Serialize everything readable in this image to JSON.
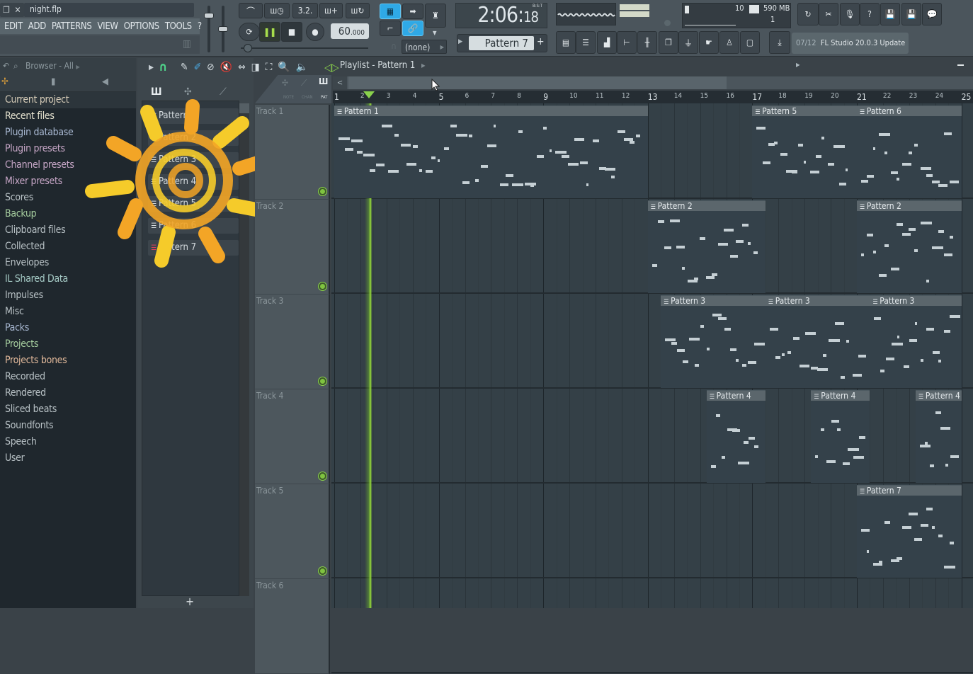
{
  "window": {
    "title": "night.flp"
  },
  "menu": [
    "EDIT",
    "ADD",
    "PATTERNS",
    "VIEW",
    "OPTIONS",
    "TOOLS",
    "?"
  ],
  "transport": {
    "time_main": "2:06",
    "time_sub": "18",
    "time_mode": "B:S:T",
    "tempo_main": "60",
    "tempo_sub": ".000",
    "pattern_selected": "Pattern 7",
    "snap_value": "(none)",
    "state": "playing"
  },
  "toolbar_buttons": [
    "metronome",
    "wait-for-input",
    "countdown-3-2-1",
    "blend-notes",
    "loop-record",
    "step-edit",
    "typing-keyboard",
    "main-volume",
    "record-from-step",
    "link"
  ],
  "monitor": {
    "cpu": "10",
    "memory": "590 MB",
    "polyphony": "1"
  },
  "view_buttons": [
    "playlist",
    "step-sequencer",
    "piano-roll",
    "browser",
    "mixer",
    "channel-rack",
    "plugin-picker",
    "touch-controller",
    "one-click-audio-recording",
    "template"
  ],
  "right_buttons": [
    "undo",
    "cut",
    "record-audio",
    "help",
    "save",
    "save-as",
    "chat"
  ],
  "news": {
    "date": "07/12",
    "text": "FL Studio 20.0.3 Update"
  },
  "browser": {
    "header": "Browser - All",
    "items": [
      {
        "label": "Current project",
        "color": "#d6ccb8",
        "selected": true
      },
      {
        "label": "Recent files",
        "color": "#e6e3d0"
      },
      {
        "label": "Plugin database",
        "color": "#a9b9d3"
      },
      {
        "label": "Plugin presets",
        "color": "#c6a6c6"
      },
      {
        "label": "Channel presets",
        "color": "#c6a6c6"
      },
      {
        "label": "Mixer presets",
        "color": "#c6a6c6"
      },
      {
        "label": "Scores",
        "color": "#b7c0c4"
      },
      {
        "label": "Backup",
        "color": "#a7cfa0"
      },
      {
        "label": "Clipboard files",
        "color": "#b7c0c4"
      },
      {
        "label": "Collected",
        "color": "#b7c0c4"
      },
      {
        "label": "Envelopes",
        "color": "#b7c0c4"
      },
      {
        "label": "IL Shared Data",
        "color": "#a6cbc6"
      },
      {
        "label": "Impulses",
        "color": "#b7c0c4"
      },
      {
        "label": "Misc",
        "color": "#b7c0c4"
      },
      {
        "label": "Packs",
        "color": "#a9b9d3"
      },
      {
        "label": "Projects",
        "color": "#a7cfa0"
      },
      {
        "label": "Projects bones",
        "color": "#e0b89a"
      },
      {
        "label": "Recorded",
        "color": "#b7c0c4"
      },
      {
        "label": "Rendered",
        "color": "#b7c0c4"
      },
      {
        "label": "Sliced beats",
        "color": "#b7c0c4"
      },
      {
        "label": "Soundfonts",
        "color": "#b7c0c4"
      },
      {
        "label": "Speech",
        "color": "#b7c0c4"
      },
      {
        "label": "User",
        "color": "#b7c0c4"
      }
    ]
  },
  "picker": {
    "tabs": [
      "notes",
      "audio",
      "automation"
    ],
    "patterns": [
      "Pattern 1",
      "Pattern 2",
      "Pattern 3",
      "Pattern 4",
      "Pattern 5",
      "Pattern 6",
      "Pattern 7"
    ],
    "current": "Pattern 7",
    "add_label": "+"
  },
  "playlist": {
    "title": "Playlist - Pattern 1",
    "filter_labels": [
      "NOTE",
      "CHAN",
      "PAT"
    ],
    "bars": [
      "1",
      "2",
      "3",
      "4",
      "5",
      "6",
      "7",
      "8",
      "9",
      "10",
      "11",
      "12",
      "13",
      "14",
      "15",
      "16",
      "17",
      "18",
      "19",
      "20",
      "21",
      "22",
      "23",
      "24",
      "25"
    ],
    "playhead_bar": 2.3,
    "tracks": [
      "Track 1",
      "Track 2",
      "Track 3",
      "Track 4",
      "Track 5",
      "Track 6"
    ],
    "clips": [
      {
        "track": 0,
        "name": "Pattern 1",
        "start": 1,
        "end": 13
      },
      {
        "track": 0,
        "name": "Pattern 5",
        "start": 17,
        "end": 21
      },
      {
        "track": 0,
        "name": "Pattern 6",
        "start": 21,
        "end": 25
      },
      {
        "track": 1,
        "name": "Pattern 2",
        "start": 13,
        "end": 17.5
      },
      {
        "track": 1,
        "name": "Pattern 2",
        "start": 21,
        "end": 25
      },
      {
        "track": 2,
        "name": "Pattern 3",
        "start": 13.5,
        "end": 17.5
      },
      {
        "track": 2,
        "name": "Pattern 3",
        "start": 17.5,
        "end": 21.5
      },
      {
        "track": 2,
        "name": "Pattern 3",
        "start": 21.5,
        "end": 25
      },
      {
        "track": 3,
        "name": "Pattern 4",
        "start": 15.25,
        "end": 17.5
      },
      {
        "track": 3,
        "name": "Pattern 4",
        "start": 19.25,
        "end": 21.5
      },
      {
        "track": 3,
        "name": "Pattern 4",
        "start": 23.25,
        "end": 25
      },
      {
        "track": 4,
        "name": "Pattern 7",
        "start": 21,
        "end": 25
      }
    ]
  }
}
